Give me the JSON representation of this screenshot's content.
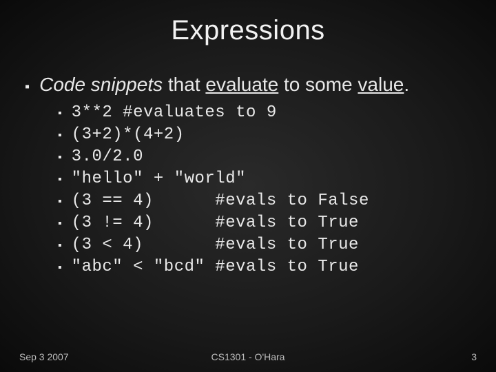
{
  "title": "Expressions",
  "bullet_line": {
    "prefix_italic": "Code snippets",
    "plain1": " that ",
    "u1": "evaluate",
    "plain2": " to some ",
    "u2": "value",
    "plain3": "."
  },
  "code_lines": [
    "3**2 #evaluates to 9",
    "(3+2)*(4+2)",
    "3.0/2.0",
    "\"hello\" + \"world\"",
    "(3 == 4)      #evals to False",
    "(3 != 4)      #evals to True",
    "(3 < 4)       #evals to True",
    "\"abc\" < \"bcd\" #evals to True"
  ],
  "footer": {
    "left": "Sep 3 2007",
    "center": "CS1301 - O'Hara",
    "right": "3"
  }
}
